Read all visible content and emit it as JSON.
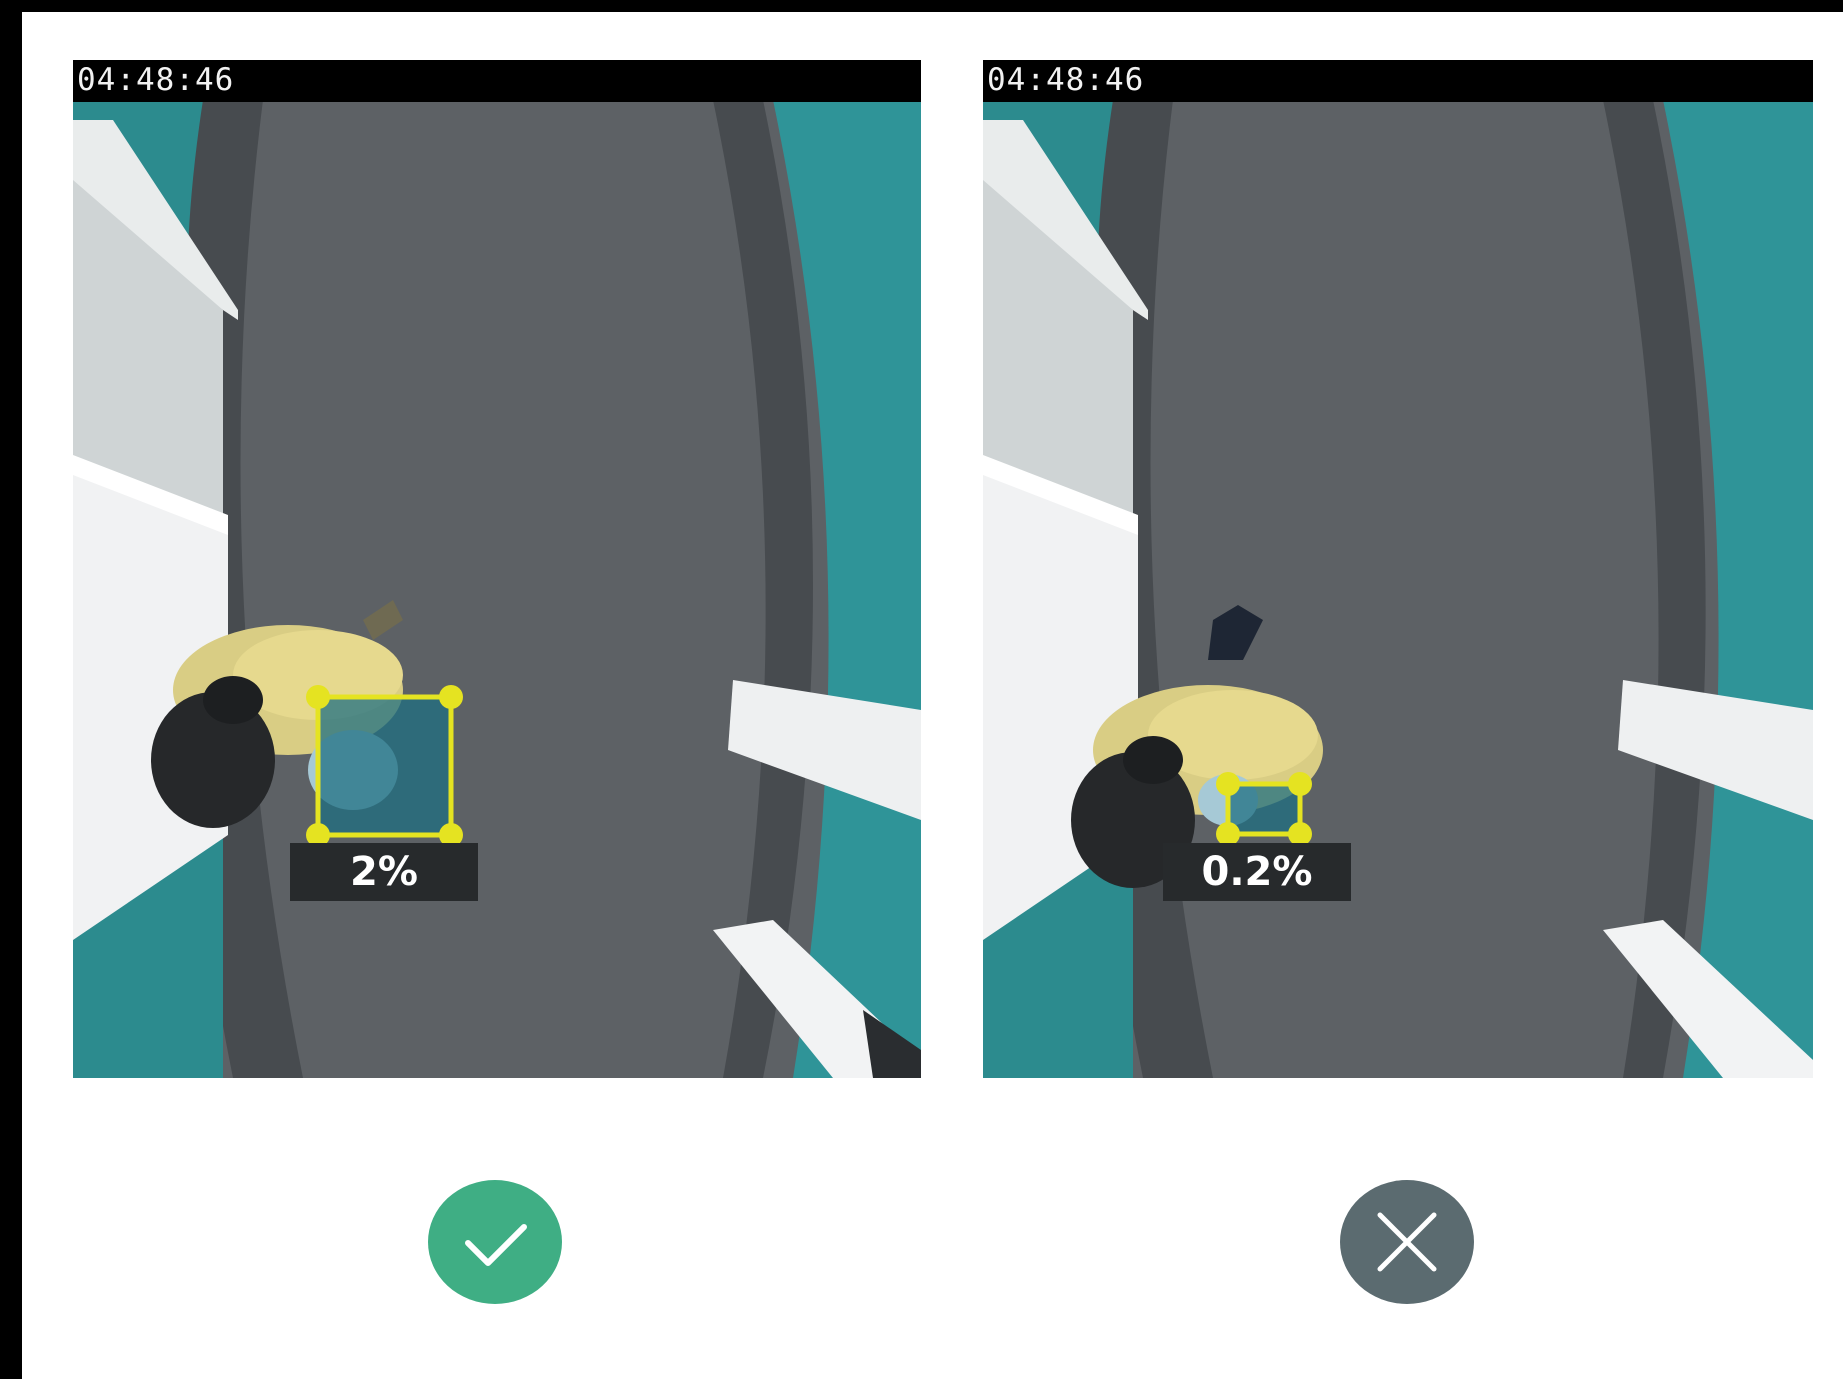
{
  "panels": [
    {
      "timestamp": "04:48:46",
      "label": "2%",
      "verdict": "correct",
      "verdict_icon": "checkmark-icon",
      "verdict_color": "#3fae84"
    },
    {
      "timestamp": "04:48:46",
      "label": "0.2%",
      "verdict": "incorrect",
      "verdict_icon": "close-icon",
      "verdict_color": "#5b6b70"
    }
  ],
  "colors": {
    "box": "#e5e321",
    "box_fill": "#1f6f82",
    "floor": "#5b5f63",
    "wall": "#2f8d92"
  }
}
